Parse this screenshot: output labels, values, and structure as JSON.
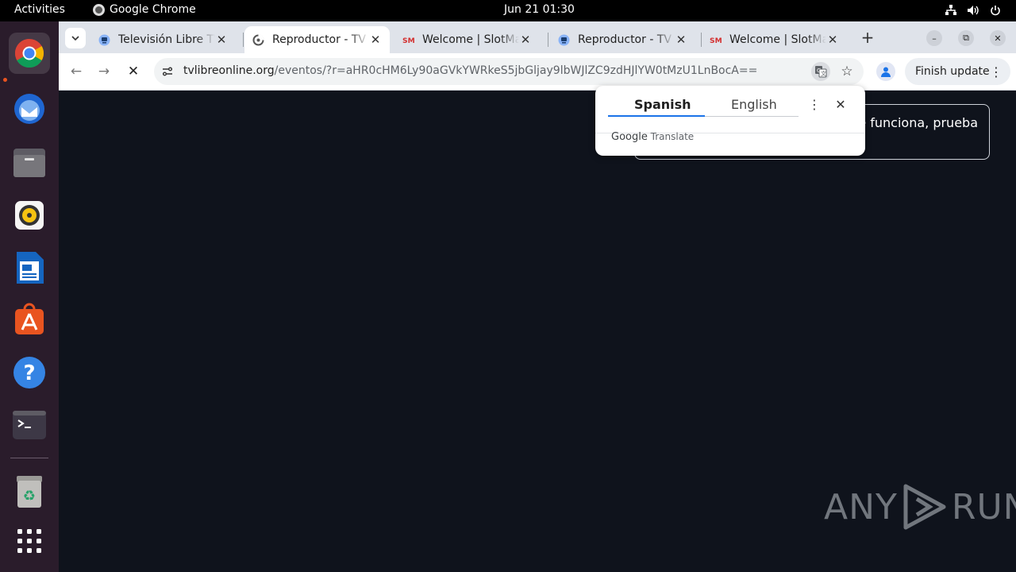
{
  "topbar": {
    "activities": "Activities",
    "app_name": "Google Chrome",
    "clock": "Jun 21  01:30"
  },
  "dock": {
    "items": [
      "chrome-icon",
      "thunderbird-icon",
      "files-icon",
      "rhythmbox-icon",
      "writer-icon",
      "app-center-icon",
      "help-icon",
      "terminal-icon",
      "trash-icon",
      "app-grid-icon"
    ]
  },
  "tabs": [
    {
      "title": "Televisión Libre TV",
      "favicon": "tv-favicon",
      "active": false
    },
    {
      "title": "Reproductor - TV Libre",
      "favicon": "loading-favicon",
      "active": true
    },
    {
      "title": "Welcome | SlotMania",
      "favicon": "sm-favicon",
      "active": false
    },
    {
      "title": "Reproductor - TV Libre",
      "favicon": "tv-favicon",
      "active": false
    },
    {
      "title": "Welcome | SlotMania",
      "favicon": "sm-favicon",
      "active": false
    }
  ],
  "toolbar": {
    "url_host": "tvlibreonline.org",
    "url_path": "/eventos/?r=aHR0cHM6Ly90aGVkYWRkeS5jbGljay9lbWJlZC9zdHJlYW0tMzU1LnBocA==",
    "finish_update": "Finish update"
  },
  "page": {
    "notice_text": "te funciona, prueba"
  },
  "translate": {
    "source_lang": "Spanish",
    "target_lang": "English",
    "brand_google": "Google",
    "brand_translate": "Translate"
  },
  "watermark": {
    "left": "ANY",
    "right": "RUN"
  },
  "colors": {
    "page_bg": "#0f131c",
    "accent": "#1a73e8",
    "dock_bg": "#2a1c2b",
    "ubuntu_orange": "#e95420"
  }
}
